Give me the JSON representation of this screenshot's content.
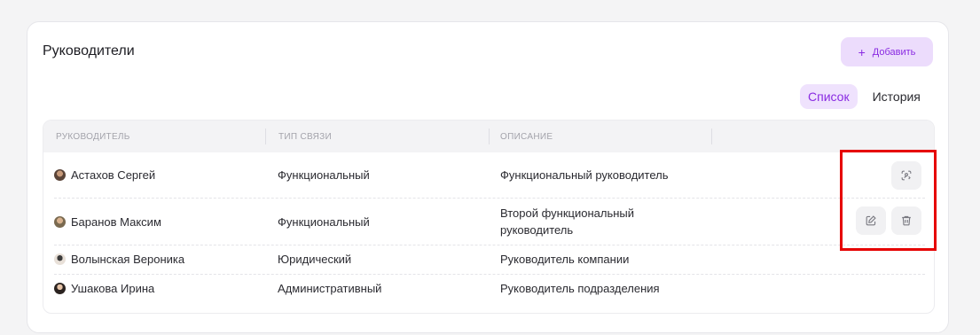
{
  "card": {
    "title": "Руководители",
    "add_button": {
      "icon": "plus-icon",
      "label": "Добавить"
    }
  },
  "tabs": [
    {
      "label": "Список",
      "active": true
    },
    {
      "label": "История",
      "active": false
    }
  ],
  "table": {
    "columns": [
      "РУКОВОДИТЕЛЬ",
      "ТИП СВЯЗИ",
      "ОПИСАНИЕ"
    ],
    "rows": [
      {
        "name": "Астахов Сергей",
        "type": "Функциональный",
        "description": "Функциональный руководитель",
        "actions": [
          "swap-user-icon"
        ]
      },
      {
        "name": "Баранов Максим",
        "type": "Функциональный",
        "description": "Второй функциональный руководитель",
        "actions": [
          "edit-icon",
          "trash-icon"
        ]
      },
      {
        "name": "Волынская Вероника",
        "type": "Юридический",
        "description": "Руководитель компании",
        "actions": []
      },
      {
        "name": "Ушакова Ирина",
        "type": "Административный",
        "description": "Руководитель подразделения",
        "actions": []
      }
    ]
  },
  "colors": {
    "accent": "#8a2be2",
    "accent_bg": "#ecdcfc",
    "highlight": "#e60000"
  }
}
